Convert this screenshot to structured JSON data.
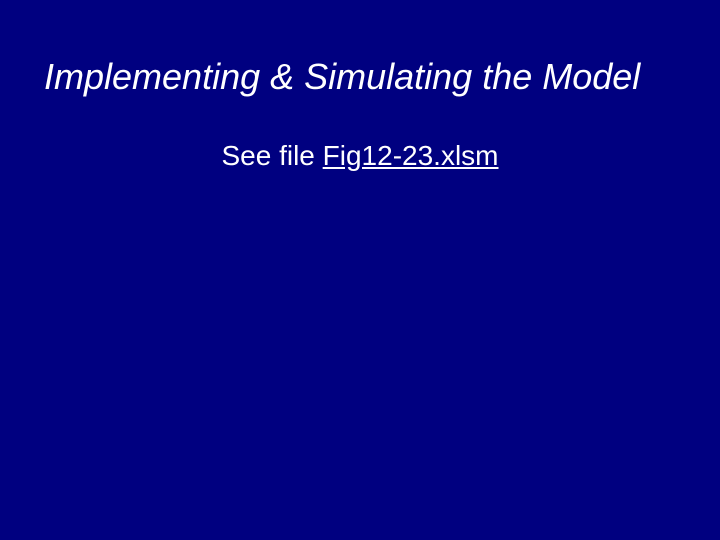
{
  "slide": {
    "title": "Implementing & Simulating the Model",
    "subtitle_prefix": "See file ",
    "file_link": "Fig12-23.xlsm"
  }
}
